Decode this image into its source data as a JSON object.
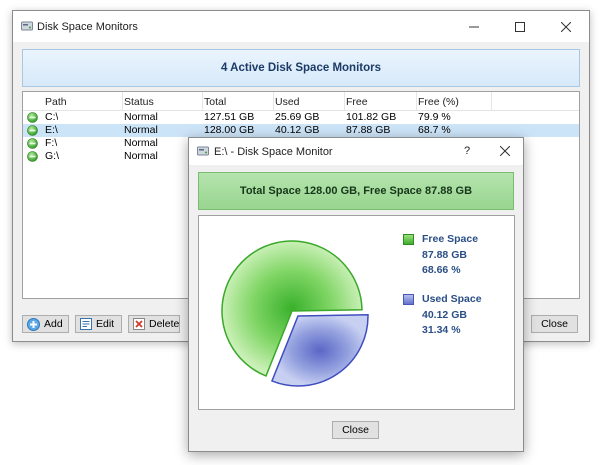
{
  "main_window": {
    "title": "Disk Space Monitors",
    "banner": "4 Active Disk Space Monitors",
    "columns": [
      "Path",
      "Status",
      "Total",
      "Used",
      "Free",
      "Free (%)"
    ],
    "rows": [
      {
        "path": "C:\\",
        "status": "Normal",
        "total": "127.51 GB",
        "used": "25.69 GB",
        "free": "101.82 GB",
        "free_pct": "79.9 %",
        "selected": false
      },
      {
        "path": "E:\\",
        "status": "Normal",
        "total": "128.00 GB",
        "used": "40.12 GB",
        "free": "87.88 GB",
        "free_pct": "68.7 %",
        "selected": true
      },
      {
        "path": "F:\\",
        "status": "Normal",
        "total": "",
        "used": "",
        "free": "",
        "free_pct": "",
        "selected": false
      },
      {
        "path": "G:\\",
        "status": "Normal",
        "total": "",
        "used": "",
        "free": "",
        "free_pct": "",
        "selected": false
      }
    ],
    "buttons": {
      "add": "Add",
      "edit": "Edit",
      "delete": "Delete",
      "close": "Close"
    },
    "status_icon": "green-status-icon"
  },
  "dialog": {
    "title": "E:\\ - Disk Space Monitor",
    "help": "?",
    "banner": "Total Space 128.00 GB, Free Space 87.88 GB",
    "close_button": "Close"
  },
  "chart_data": {
    "type": "pie",
    "slices": [
      {
        "name": "Free Space",
        "value": 87.88,
        "value_label": "87.88 GB",
        "percent": 68.66,
        "percent_label": "68.66 %",
        "color": "#66cc44"
      },
      {
        "name": "Used Space",
        "value": 40.12,
        "value_label": "40.12 GB",
        "percent": 31.34,
        "percent_label": "31.34 %",
        "color": "#8899dd"
      }
    ],
    "legend_position": "right"
  }
}
